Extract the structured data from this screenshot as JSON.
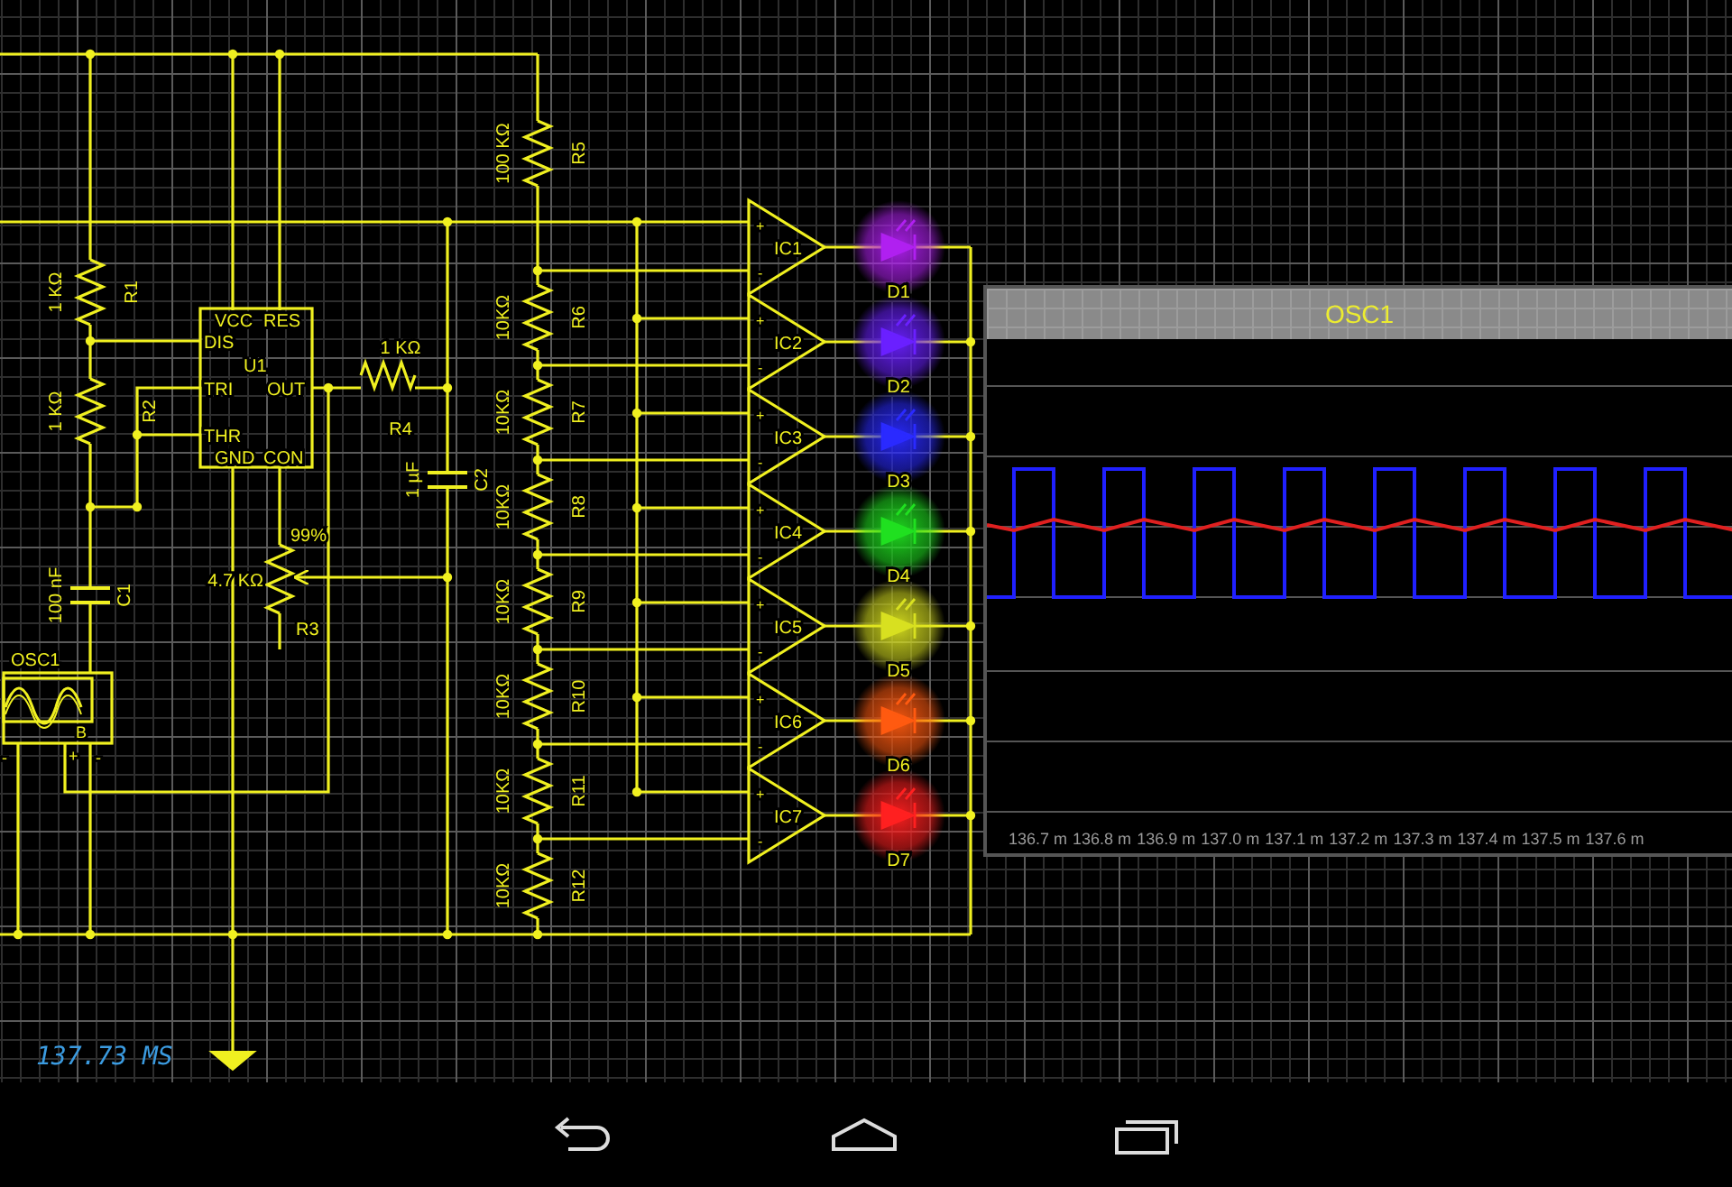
{
  "schematic": {
    "timer": "137.73 MS",
    "timer_ic": {
      "name": "U1",
      "pins": [
        "VCC",
        "RES",
        "DIS",
        "TRI",
        "OUT",
        "THR",
        "GND",
        "CON"
      ]
    },
    "resistors": [
      {
        "name": "R1",
        "value": "1 KΩ"
      },
      {
        "name": "R2",
        "value": "1 KΩ"
      },
      {
        "name": "R4",
        "value": "1 KΩ"
      },
      {
        "name": "R5",
        "value": "100 KΩ"
      },
      {
        "name": "R6",
        "value": "10KΩ"
      },
      {
        "name": "R7",
        "value": "10KΩ"
      },
      {
        "name": "R8",
        "value": "10KΩ"
      },
      {
        "name": "R9",
        "value": "10KΩ"
      },
      {
        "name": "R10",
        "value": "10KΩ"
      },
      {
        "name": "R11",
        "value": "10KΩ"
      },
      {
        "name": "R12",
        "value": "10KΩ"
      }
    ],
    "capacitors": [
      {
        "name": "C1",
        "value": "100 nF"
      },
      {
        "name": "C2",
        "value": "1 µF"
      }
    ],
    "potentiometer": {
      "name": "R3",
      "value": "4.7 KΩ",
      "setting": "99%"
    },
    "oscillator": {
      "name": "OSC1",
      "pins": [
        "-",
        "B",
        "+",
        "-"
      ]
    },
    "comparators": [
      {
        "name": "IC1",
        "inputs": [
          "+",
          "-"
        ]
      },
      {
        "name": "IC2",
        "inputs": [
          "+",
          "-"
        ]
      },
      {
        "name": "IC3",
        "inputs": [
          "+",
          "-"
        ]
      },
      {
        "name": "IC4",
        "inputs": [
          "+",
          "-"
        ]
      },
      {
        "name": "IC5",
        "inputs": [
          "+",
          "-"
        ]
      },
      {
        "name": "IC6",
        "inputs": [
          "+",
          "-"
        ]
      },
      {
        "name": "IC7",
        "inputs": [
          "+",
          "-"
        ]
      }
    ],
    "leds": [
      {
        "name": "D1",
        "color": "#b020f0"
      },
      {
        "name": "D2",
        "color": "#6a20ff"
      },
      {
        "name": "D3",
        "color": "#2a2aff"
      },
      {
        "name": "D4",
        "color": "#20e020"
      },
      {
        "name": "D5",
        "color": "#d8e020"
      },
      {
        "name": "D6",
        "color": "#ff5a10"
      },
      {
        "name": "D7",
        "color": "#ff2020"
      }
    ]
  },
  "scope": {
    "title": "OSC1",
    "tick_labels": [
      "136.7 m",
      "136.8 m",
      "136.9 m",
      "137.0 m",
      "137.1 m",
      "137.2 m",
      "137.3 m",
      "137.4 m",
      "137.5 m",
      "137.6 m"
    ]
  }
}
